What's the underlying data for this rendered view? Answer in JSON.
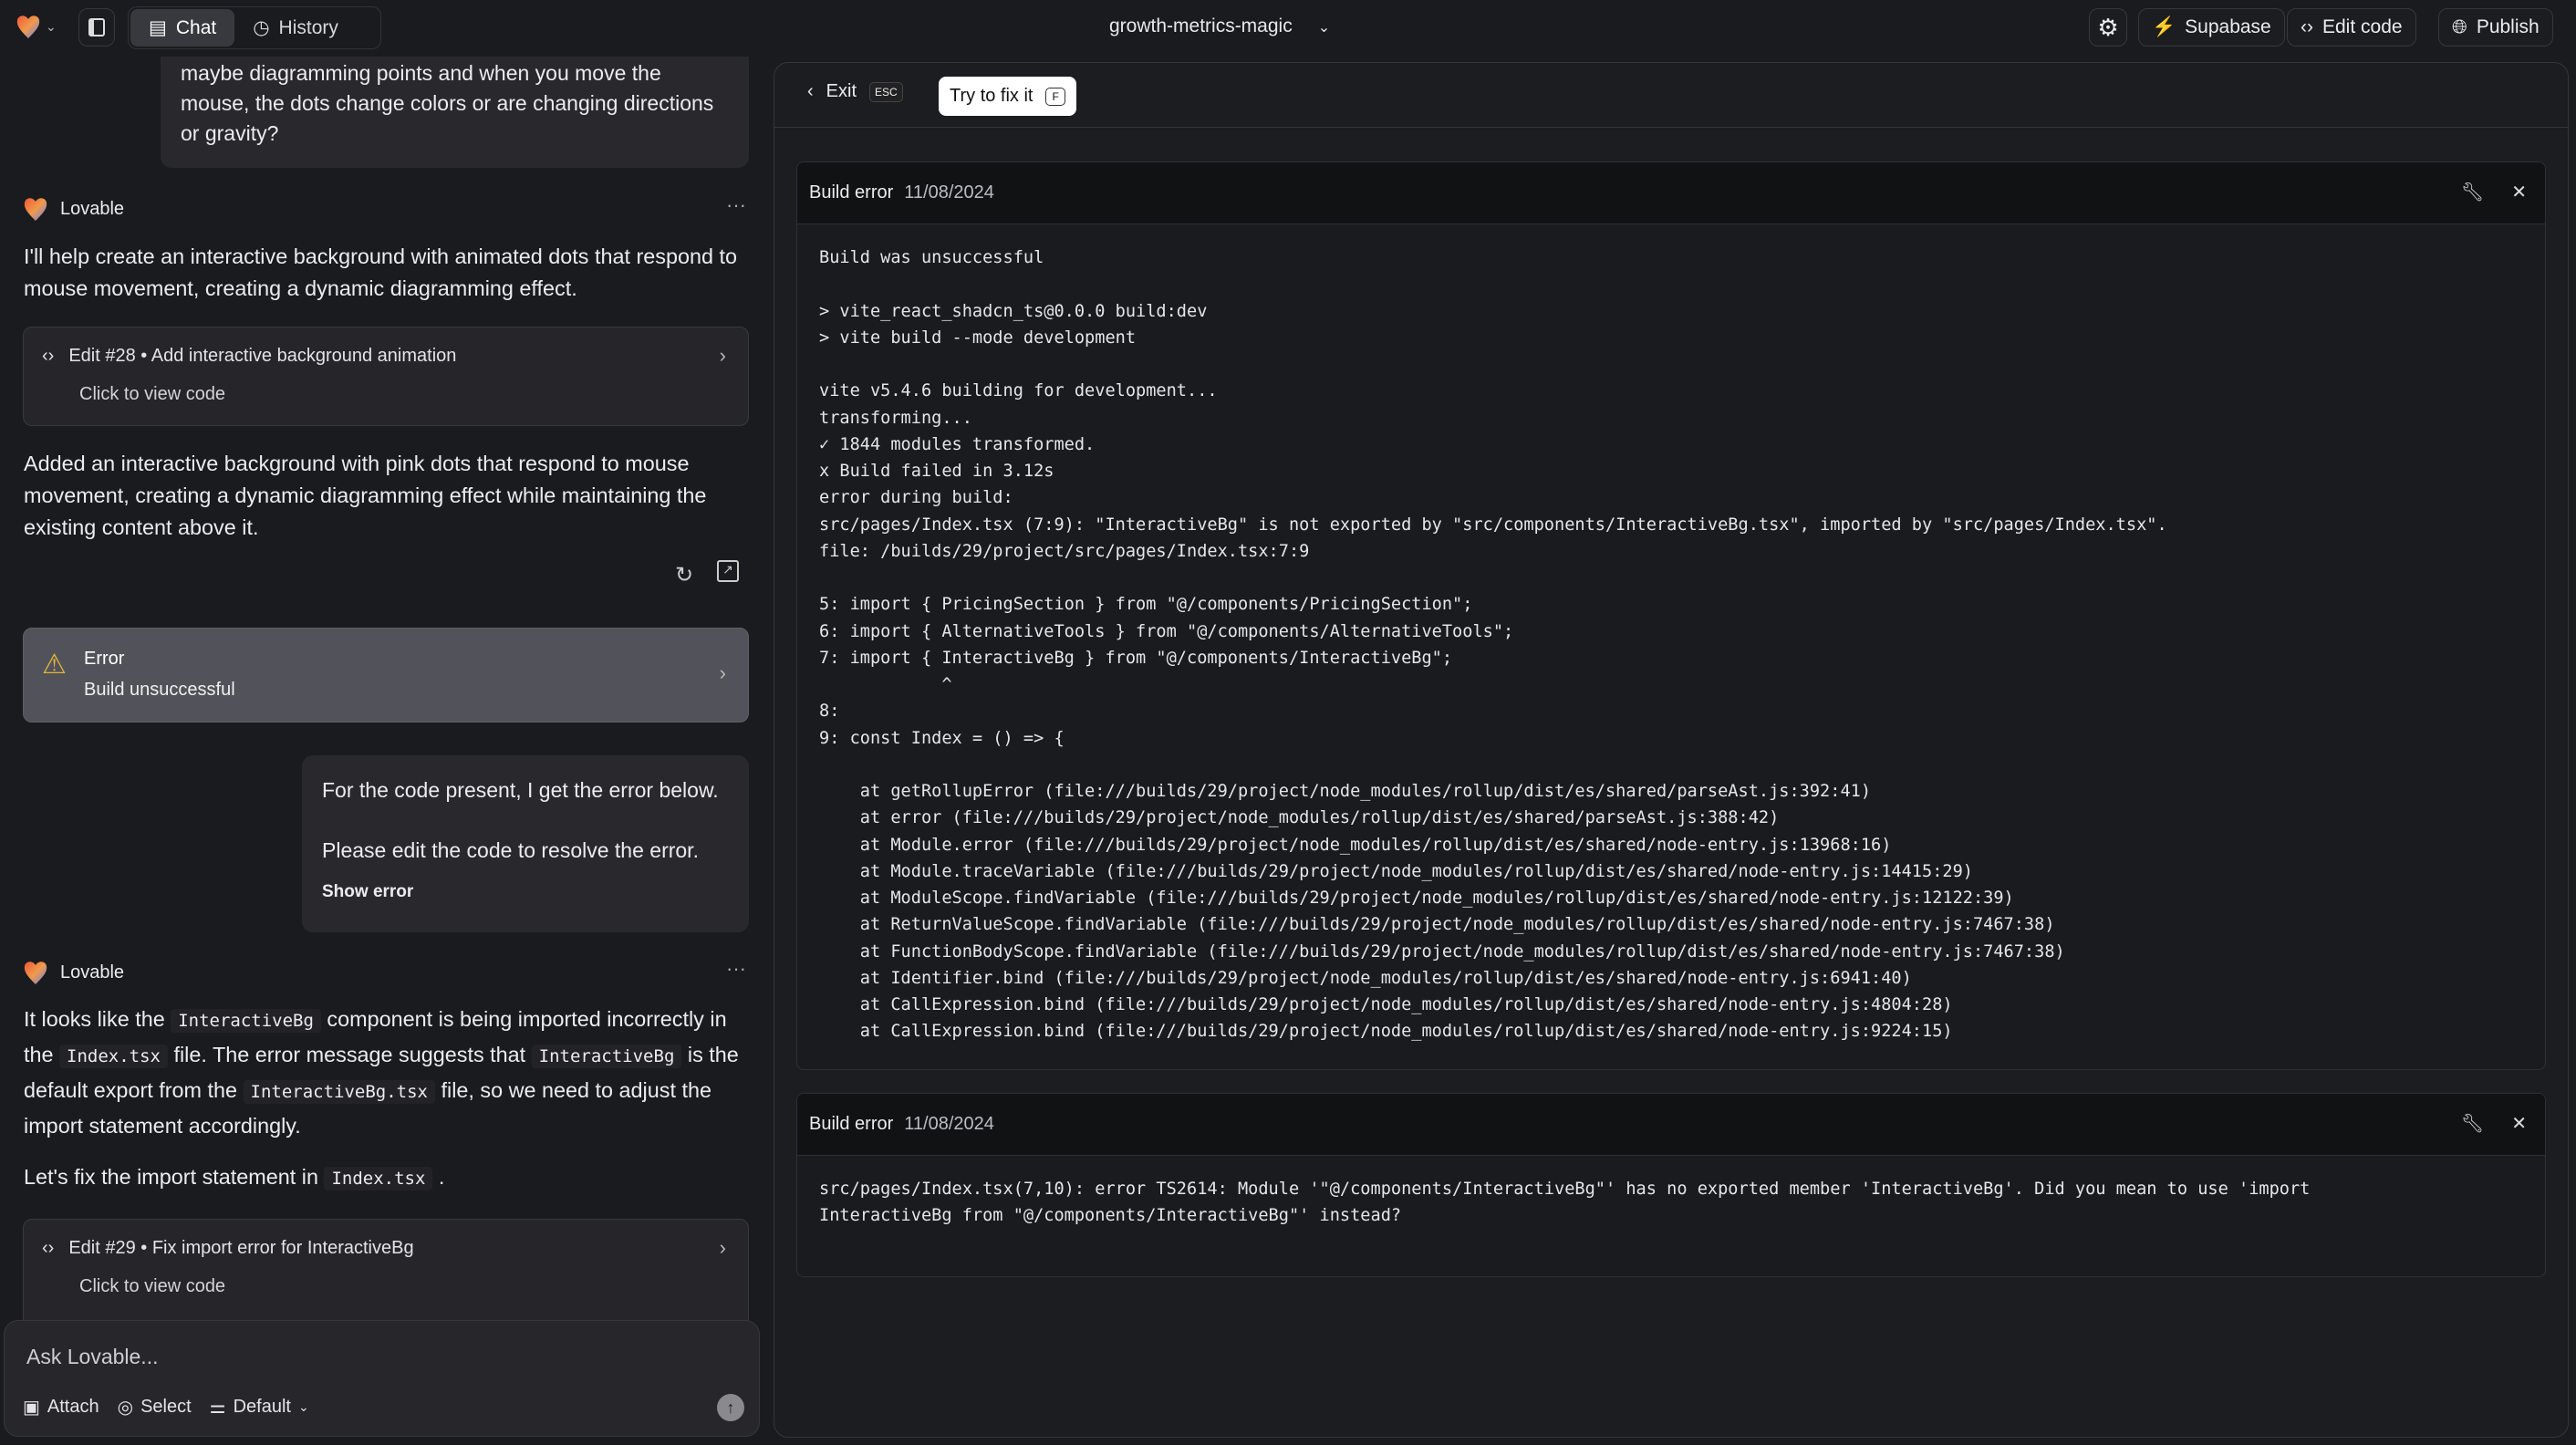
{
  "header": {
    "chat_tab": "Chat",
    "history_tab": "History",
    "project_name": "growth-metrics-magic",
    "supabase_label": "Supabase",
    "edit_code_label": "Edit code",
    "publish_label": "Publish"
  },
  "chat": {
    "user_message_1": "maybe diagramming points and when you move the mouse, the dots change colors or are changing directions or gravity?",
    "assistant_name": "Lovable",
    "assistant_1_intro": "I'll help create an interactive background with animated dots that respond to mouse movement, creating a dynamic diagramming effect.",
    "edit_28": {
      "title": "Edit #28 • Add interactive background animation",
      "subtitle": "Click to view code"
    },
    "assistant_1_summary": "Added an interactive background with pink dots that respond to mouse movement, creating a dynamic diagramming effect while maintaining the existing content above it.",
    "error_card": {
      "title": "Error",
      "subtitle": "Build unsuccessful"
    },
    "user_message_2": {
      "line1": "For the code present, I get the error below.",
      "line2": "Please edit the code to resolve the error.",
      "show_error": "Show error"
    },
    "assistant_2": {
      "p1": [
        "It looks like the ",
        "InteractiveBg",
        " component is being imported incorrectly in the ",
        "Index.tsx",
        " file. The error message suggests that ",
        "InteractiveBg",
        " is the default export from the ",
        "InteractiveBg.tsx",
        " file, so we need to adjust the import statement accordingly."
      ],
      "p2": [
        "Let's fix the import statement in ",
        "Index.tsx",
        " ."
      ]
    },
    "edit_29": {
      "title": "Edit #29 • Fix import error for InteractiveBg",
      "subtitle": "Click to view code"
    }
  },
  "composer": {
    "placeholder": "Ask Lovable...",
    "attach": "Attach",
    "select": "Select",
    "mode": "Default"
  },
  "error_view": {
    "exit_label": "Exit",
    "exit_shortcut": "ESC",
    "fix_label": "Try to fix it",
    "fix_shortcut": "F",
    "errors": [
      {
        "title": "Build error",
        "date": "11/08/2024",
        "log": "Build was unsuccessful\n\n> vite_react_shadcn_ts@0.0.0 build:dev\n> vite build --mode development\n\nvite v5.4.6 building for development...\ntransforming...\n✓ 1844 modules transformed.\nx Build failed in 3.12s\nerror during build:\nsrc/pages/Index.tsx (7:9): \"InteractiveBg\" is not exported by \"src/components/InteractiveBg.tsx\", imported by \"src/pages/Index.tsx\".\nfile: /builds/29/project/src/pages/Index.tsx:7:9\n\n5: import { PricingSection } from \"@/components/PricingSection\";\n6: import { AlternativeTools } from \"@/components/AlternativeTools\";\n7: import { InteractiveBg } from \"@/components/InteractiveBg\";\n            ^\n8: \n9: const Index = () => {\n\n    at getRollupError (file:///builds/29/project/node_modules/rollup/dist/es/shared/parseAst.js:392:41)\n    at error (file:///builds/29/project/node_modules/rollup/dist/es/shared/parseAst.js:388:42)\n    at Module.error (file:///builds/29/project/node_modules/rollup/dist/es/shared/node-entry.js:13968:16)\n    at Module.traceVariable (file:///builds/29/project/node_modules/rollup/dist/es/shared/node-entry.js:14415:29)\n    at ModuleScope.findVariable (file:///builds/29/project/node_modules/rollup/dist/es/shared/node-entry.js:12122:39)\n    at ReturnValueScope.findVariable (file:///builds/29/project/node_modules/rollup/dist/es/shared/node-entry.js:7467:38)\n    at FunctionBodyScope.findVariable (file:///builds/29/project/node_modules/rollup/dist/es/shared/node-entry.js:7467:38)\n    at Identifier.bind (file:///builds/29/project/node_modules/rollup/dist/es/shared/node-entry.js:6941:40)\n    at CallExpression.bind (file:///builds/29/project/node_modules/rollup/dist/es/shared/node-entry.js:4804:28)\n    at CallExpression.bind (file:///builds/29/project/node_modules/rollup/dist/es/shared/node-entry.js:9224:15)"
      },
      {
        "title": "Build error",
        "date": "11/08/2024",
        "log": "src/pages/Index.tsx(7,10): error TS2614: Module '\"@/components/InteractiveBg\"' has no exported member 'InteractiveBg'. Did you mean to use 'import\nInteractiveBg from \"@/components/InteractiveBg\"' instead?"
      }
    ]
  },
  "colors": {
    "supabase_green": "#3ecf8e",
    "warning": "#e0b43c",
    "error_card_bg": "#52525a"
  }
}
